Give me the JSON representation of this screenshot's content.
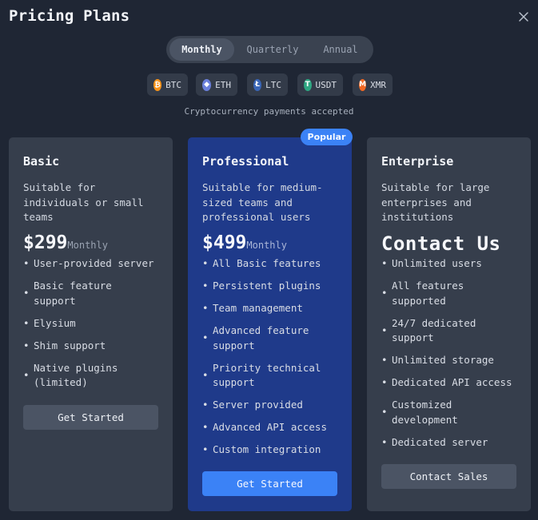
{
  "title": "Pricing Plans",
  "periods": [
    "Monthly",
    "Quarterly",
    "Annual"
  ],
  "selected_period": "Monthly",
  "coins": [
    {
      "label": "BTC",
      "icon": "bitcoin-icon",
      "glyph": "₿",
      "color": "#f7931a"
    },
    {
      "label": "ETH",
      "icon": "ethereum-icon",
      "glyph": "◆",
      "color": "#6a7fdb"
    },
    {
      "label": "LTC",
      "icon": "litecoin-icon",
      "glyph": "Ł",
      "color": "#3a66b7"
    },
    {
      "label": "USDT",
      "icon": "tether-icon",
      "glyph": "T",
      "color": "#2ea883"
    },
    {
      "label": "XMR",
      "icon": "monero-icon",
      "glyph": "M",
      "color": "#f26822"
    }
  ],
  "crypto_note": "Cryptocurrency payments accepted",
  "badge": "Popular",
  "plans": [
    {
      "name": "Basic",
      "desc": "Suitable for individuals or small teams",
      "price": "$299",
      "period_label": "Monthly",
      "features": [
        "User-provided server",
        "Basic feature support",
        "Elysium",
        "Shim support",
        "Native plugins (limited)"
      ],
      "cta": "Get Started"
    },
    {
      "name": "Professional",
      "desc": "Suitable for medium-sized teams and professional users",
      "price": "$499",
      "period_label": "Monthly",
      "features": [
        "All Basic features",
        "Persistent plugins",
        "Team management",
        "Advanced feature support",
        "Priority technical support",
        "Server provided",
        "Advanced API access",
        "Custom integration"
      ],
      "cta": "Get Started"
    },
    {
      "name": "Enterprise",
      "desc": "Suitable for large enterprises and institutions",
      "price": "Contact Us",
      "features": [
        "Unlimited users",
        "All features supported",
        "24/7 dedicated support",
        "Unlimited storage",
        "Dedicated API access",
        "Customized development",
        "Dedicated server"
      ],
      "cta": "Contact Sales"
    }
  ],
  "colors": {
    "background": "#1f2634",
    "card": "#363e4c",
    "card_highlight": "#1f3a8a",
    "accent": "#3b82f6"
  }
}
